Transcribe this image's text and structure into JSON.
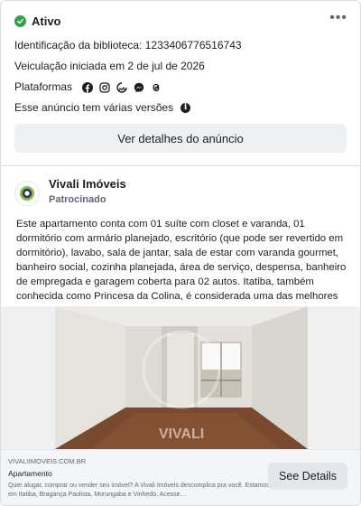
{
  "status": {
    "label": "Ativo"
  },
  "more_menu": {
    "label": "•••"
  },
  "meta": {
    "library_id": "Identificação da biblioteca: 1233406776516743",
    "started": "Veiculação iniciada em 2 de jul de 2026",
    "platforms_label": "Plataformas",
    "platform_icons": [
      "facebook-icon",
      "instagram-icon",
      "audience-network-icon",
      "messenger-icon",
      "threads-icon"
    ],
    "versions_note": "Esse anúncio tem várias versões"
  },
  "details_button": {
    "label": "Ver detalhes do anúncio"
  },
  "advertiser": {
    "name": "Vivali Imóveis",
    "sponsored": "Patrocinado"
  },
  "ad_text": "Este apartamento conta com 01 suíte com closet e varanda, 01 dormitório com armário planejado, escritório (que pode ser revertido em dormitório), lavabo, sala de jantar, sala de estar com varanda gourmet, banheiro social, cozinha planejada, área de serviço, despensa, banheiro de empregada e garagem coberta para 02 autos. Itatiba, também conhecida como Princesa da Colina, é considerada uma das melhores cidades do Estado de São Paulo em termos de infraestrutura e desenvolvimento. Ideal para quem …",
  "media": {
    "watermark": "VIVALI"
  },
  "link": {
    "domain": "VIVALIIMOVEIS.COM.BR",
    "title": "Apartamento",
    "description": "Quer alugar, comprar ou vender seu imóvel? A Vivali Imóveis descomplica pra você. Estamos em Itatiba, Bragança Paulista, Morungaba e Vinhedo. Acesse…",
    "cta": "See Details"
  },
  "colors": {
    "active_green": "#31a24c",
    "brand_green": "#7bc043",
    "brand_purple": "#3b2a6b"
  }
}
